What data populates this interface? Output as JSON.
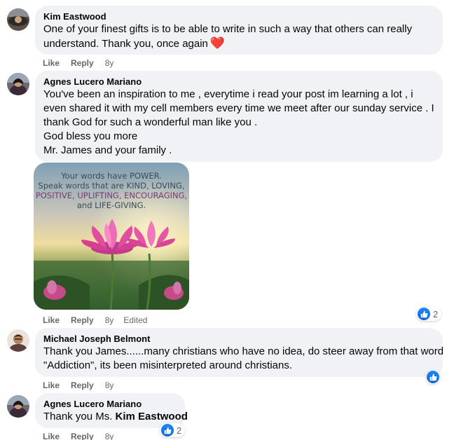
{
  "colors": {
    "bubble_bg": "#f0f2f5",
    "meta_text": "#65676b",
    "like_blue": "#1877f2",
    "heart_red": "#e8262e"
  },
  "comments": [
    {
      "author": "Kim Eastwood",
      "lines": [
        "One of your finest gifts is to be able to write in such a way that others can really",
        "understand. Thank you, once again"
      ],
      "emoji": "heart-icon",
      "like_label": "Like",
      "reply_label": "Reply",
      "time": "8y"
    },
    {
      "author": "Agnes Lucero Mariano",
      "lines": [
        "You've been an inspiration to me , everytime i read your post im learning a lot , i",
        "even shared it with my cell members every time we meet after our sunday service . I",
        "thank God for such a wonderful man like you .",
        "God bless you more",
        "Mr. James and your family ."
      ],
      "image": {
        "alt": "pink lotus flowers inspirational quote",
        "text_lines": [
          "Your words have POWER.",
          "Speak words that are KIND, LOVING,",
          "POSITIVE, UPLIFTING, ENCOURAGING,",
          "and LIFE-GIVING."
        ]
      },
      "like_label": "Like",
      "reply_label": "Reply",
      "time": "8y",
      "edited": "Edited",
      "reactions": {
        "icon": "like-icon",
        "count": "2"
      }
    },
    {
      "author": "Michael Joseph Belmont",
      "lines": [
        "Thank you James......many christians who have no idea, do steer away from that word",
        "\"Addiction\", its been misinterpreted around christians."
      ],
      "like_label": "Like",
      "reply_label": "Reply",
      "time": "8y",
      "reactions": {
        "icon": "like-icon"
      }
    },
    {
      "author": "Agnes Lucero Mariano",
      "text_prefix": "Thank you Ms.",
      "mention": "Kim Eastwood",
      "like_label": "Like",
      "reply_label": "Reply",
      "time": "8y",
      "reactions": {
        "icon": "like-icon",
        "count": "2"
      }
    }
  ]
}
